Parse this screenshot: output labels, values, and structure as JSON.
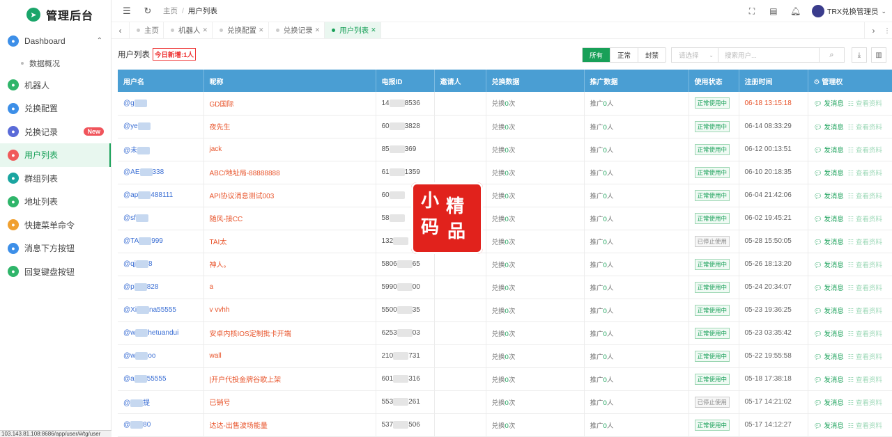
{
  "app": {
    "title": "管理后台"
  },
  "sidebar": {
    "items": [
      {
        "label": "Dashboard",
        "icon": "dashboard-icon",
        "color": "#3d8fe8"
      },
      {
        "label": "数据概况",
        "sub": true
      },
      {
        "label": "机器人",
        "icon": "robot-icon",
        "color": "#2fb56a"
      },
      {
        "label": "兑换配置",
        "icon": "exchange-icon",
        "color": "#3d8fe8"
      },
      {
        "label": "兑换记录",
        "icon": "record-icon",
        "color": "#5a6bd8",
        "badge": "New"
      },
      {
        "label": "用户列表",
        "icon": "user-icon",
        "color": "#f05a5a",
        "active": true
      },
      {
        "label": "群组列表",
        "icon": "group-icon",
        "color": "#1aa5a0"
      },
      {
        "label": "地址列表",
        "icon": "address-icon",
        "color": "#2fb56a"
      },
      {
        "label": "快捷菜单命令",
        "icon": "shortcut-icon",
        "color": "#f0a030"
      },
      {
        "label": "消息下方按钮",
        "icon": "button-icon",
        "color": "#3d8fe8"
      },
      {
        "label": "回复键盘按钮",
        "icon": "keyboard-icon",
        "color": "#2fb56a"
      }
    ],
    "url_text": "103.143.81.108:8686/app/user/#/tg/user"
  },
  "header": {
    "breadcrumb": [
      "主页",
      "用户列表"
    ],
    "user_name": "TRX兑换管理员"
  },
  "tabs": [
    {
      "label": "主页",
      "closable": false
    },
    {
      "label": "机器人",
      "closable": true
    },
    {
      "label": "兑换配置",
      "closable": true
    },
    {
      "label": "兑换记录",
      "closable": true
    },
    {
      "label": "用户列表",
      "closable": true,
      "active": true
    }
  ],
  "toolbar": {
    "title": "用户列表",
    "today_badge": "今日新增:1人",
    "filters": [
      "所有",
      "正常",
      "封禁"
    ],
    "active_filter": "所有",
    "select_placeholder": "请选择",
    "search_placeholder": "搜索用户..."
  },
  "table": {
    "headers": [
      "用户名",
      "昵称",
      "电报ID",
      "邀请人",
      "兑换数据",
      "推广数据",
      "使用状态",
      "注册时间",
      "管理权"
    ],
    "manage_icon": "gear-icon",
    "action_send": "发消息",
    "action_view": "查看资料",
    "exchange_prefix": "兑换",
    "exchange_suffix": "次",
    "promo_prefix": "推广",
    "promo_suffix": "人",
    "rows": [
      {
        "user_a": "@g",
        "user_b": "",
        "nick": "GD国际",
        "id_a": "14",
        "id_b": "8536",
        "ex": "0",
        "promo": "0",
        "status": "正常使用中",
        "active": true,
        "time": "06-18 13:15:18",
        "highlight": true
      },
      {
        "user_a": "@ye",
        "user_b": "",
        "nick": "夜先生",
        "id_a": "60",
        "id_b": "3828",
        "ex": "0",
        "promo": "0",
        "status": "正常使用中",
        "active": true,
        "time": "06-14 08:33:29"
      },
      {
        "user_a": "@未",
        "user_b": "",
        "nick": "jack",
        "id_a": "85",
        "id_b": "369",
        "ex": "0",
        "promo": "0",
        "status": "正常使用中",
        "active": true,
        "time": "06-12 00:13:51"
      },
      {
        "user_a": "@AE",
        "user_b": "338",
        "nick": "ABC/地址局-88888888",
        "id_a": "61",
        "id_b": "1359",
        "ex": "0",
        "promo": "0",
        "status": "正常使用中",
        "active": true,
        "time": "06-10 20:18:35"
      },
      {
        "user_a": "@ap",
        "user_b": "488111",
        "nick": "API协议消息测试003",
        "id_a": "60",
        "id_b": "",
        "ex": "0",
        "promo": "0",
        "status": "正常使用中",
        "active": true,
        "time": "06-04 21:42:06"
      },
      {
        "user_a": "@sf",
        "user_b": "",
        "nick": "随风-接CC",
        "id_a": "58",
        "id_b": "",
        "ex": "0",
        "promo": "0",
        "status": "正常使用中",
        "active": true,
        "time": "06-02 19:45:21"
      },
      {
        "user_a": "@TA",
        "user_b": "999",
        "nick": "TAI太",
        "id_a": "132",
        "id_b": "",
        "ex": "0",
        "promo": "0",
        "status": "已停止使用",
        "active": false,
        "time": "05-28 15:50:05"
      },
      {
        "user_a": "@qj",
        "user_b": "8",
        "nick": "神人。",
        "id_a": "5806",
        "id_b": "65",
        "ex": "0",
        "promo": "0",
        "status": "正常使用中",
        "active": true,
        "time": "05-26 18:13:20"
      },
      {
        "user_a": "@p",
        "user_b": "828",
        "nick": "a",
        "id_a": "5990",
        "id_b": "00",
        "ex": "0",
        "promo": "0",
        "status": "正常使用中",
        "active": true,
        "time": "05-24 20:34:07"
      },
      {
        "user_a": "@Xi",
        "user_b": "na55555",
        "nick": "v vvhh",
        "id_a": "5500",
        "id_b": "35",
        "ex": "0",
        "promo": "0",
        "status": "正常使用中",
        "active": true,
        "time": "05-23 19:36:25"
      },
      {
        "user_a": "@w",
        "user_b": "hetuandui",
        "nick": "安卓内核IOS定制批卡开端",
        "id_a": "6253",
        "id_b": "03",
        "ex": "0",
        "promo": "0",
        "status": "正常使用中",
        "active": true,
        "time": "05-23 03:35:42"
      },
      {
        "user_a": "@w",
        "user_b": "oo",
        "nick": "wall",
        "id_a": "210",
        "id_b": "731",
        "ex": "0",
        "promo": "0",
        "status": "正常使用中",
        "active": true,
        "time": "05-22 19:55:58"
      },
      {
        "user_a": "@a",
        "user_b": "55555",
        "nick": "|开户代投金牌谷歌上架",
        "id_a": "601",
        "id_b": "316",
        "ex": "0",
        "promo": "0",
        "status": "正常使用中",
        "active": true,
        "time": "05-18 17:38:18"
      },
      {
        "user_a": "@",
        "user_b": "提",
        "nick": "已销号",
        "id_a": "553",
        "id_b": "261",
        "ex": "0",
        "promo": "0",
        "status": "已停止使用",
        "active": false,
        "time": "05-17 14:21:02"
      },
      {
        "user_a": "@",
        "user_b": "80",
        "nick": "达达-出售波场能量",
        "id_a": "537",
        "id_b": "506",
        "ex": "0",
        "promo": "0",
        "status": "正常使用中",
        "active": true,
        "time": "05-17 14:12:27"
      }
    ]
  },
  "watermark": {
    "chars": [
      "小",
      "精",
      "码",
      "品"
    ],
    "color": "#e1221c"
  }
}
